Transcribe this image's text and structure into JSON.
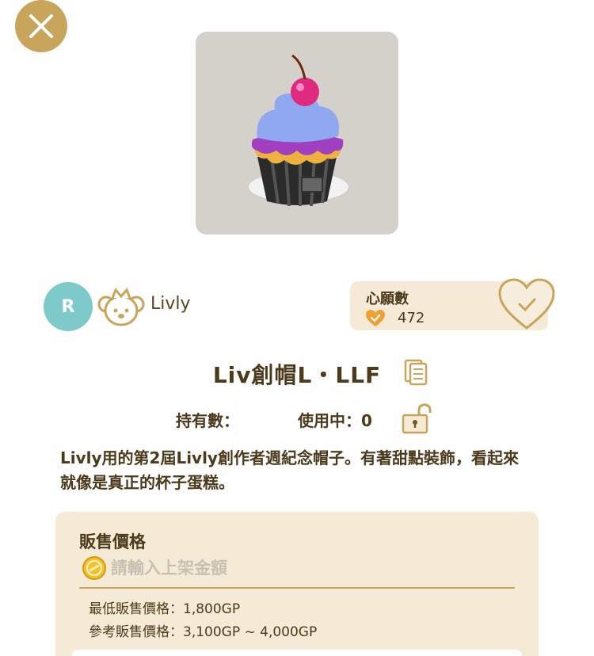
{
  "header": {
    "close_icon": "close-icon"
  },
  "item": {
    "image": "cupcake-hat-image",
    "title": "Liv創帽L・LLF",
    "owned_label": "持有數：",
    "in_use_label": "使用中：0",
    "description": "Livly用的第2屆Livly創作者週紀念帽子。有著甜點裝飾，看起來就像是真正的杯子蛋糕。"
  },
  "creator": {
    "avatar_letter": "R",
    "name": "Livly"
  },
  "wishlist": {
    "label": "心願數",
    "count": "472"
  },
  "sale": {
    "title": "販售價格",
    "placeholder": "請輸入上架金額",
    "min_price": "最低販售價格：1,800GP",
    "ref_price": "參考販售價格：3,100GP ~ 4,000GP"
  },
  "colors": {
    "accent_gold": "#c8a55a",
    "panel_beige": "#f4ead6",
    "text_brown": "#4b3a1c",
    "avatar_teal": "#7ecaca",
    "heart_orange": "#f0a030"
  }
}
